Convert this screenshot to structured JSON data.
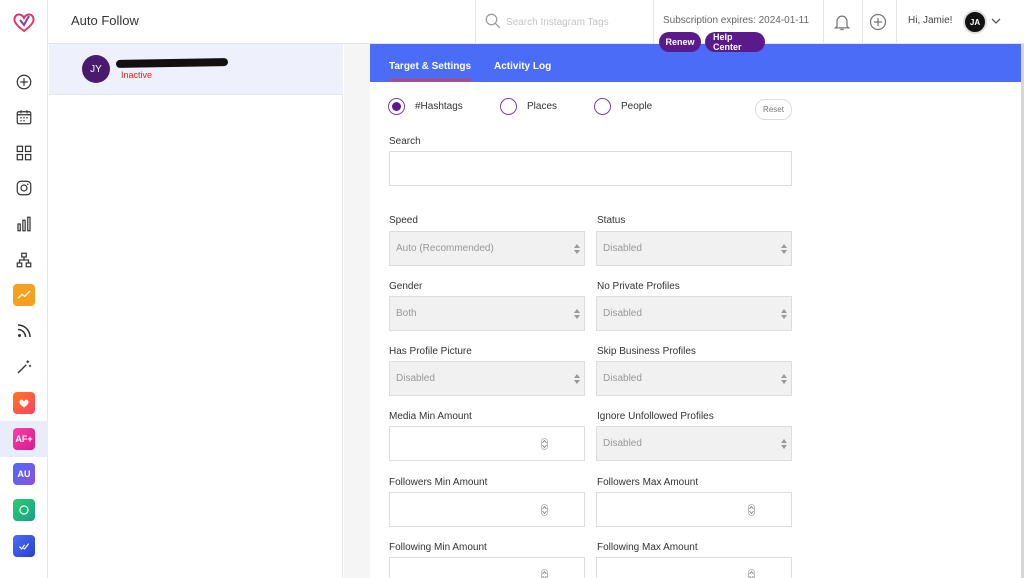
{
  "colors": {
    "brand": "#5a1a8c",
    "tabbar": "#4b6cf7",
    "tab_active_underline": "#e63a3a",
    "status_inactive": "#e0271f",
    "rail_active_bg": "#e9ecf9"
  },
  "rail": {
    "logo": "heart-logo",
    "items": [
      {
        "icon": "plus-circle-icon"
      },
      {
        "icon": "calendar-icon"
      },
      {
        "icon": "grid-icon"
      },
      {
        "icon": "instagram-icon"
      },
      {
        "icon": "bar-chart-icon"
      },
      {
        "icon": "hierarchy-icon"
      },
      {
        "icon": "trend-icon"
      },
      {
        "icon": "rss-icon"
      },
      {
        "icon": "magic-wand-icon"
      },
      {
        "icon": "auto-like-icon"
      },
      {
        "icon": "auto-follow-icon",
        "badge": "AF+",
        "active": true
      },
      {
        "icon": "auto-unfollow-icon",
        "badge": "AU"
      },
      {
        "icon": "auto-dm-icon"
      },
      {
        "icon": "checkmark-icon"
      }
    ]
  },
  "header": {
    "title": "Auto Follow",
    "search_placeholder": "Search Instagram Tags",
    "subscription_text": "Subscription expires: 2024-01-11",
    "renew_label": "Renew",
    "help_label": "Help Center",
    "greeting": "Hi, Jamie!",
    "avatar_initials": "JA"
  },
  "account": {
    "initials": "JY",
    "status": "Inactive"
  },
  "tabs": [
    {
      "label": "Target & Settings",
      "active": true
    },
    {
      "label": "Activity Log",
      "active": false
    }
  ],
  "target_types": [
    {
      "label": "#Hashtags",
      "selected": true
    },
    {
      "label": "Places",
      "selected": false
    },
    {
      "label": "People",
      "selected": false
    }
  ],
  "reset_label": "Reset",
  "search_label": "Search",
  "fields": {
    "speed": {
      "label": "Speed",
      "value": "Auto (Recommended)"
    },
    "status": {
      "label": "Status",
      "value": "Disabled"
    },
    "gender": {
      "label": "Gender",
      "value": "Both"
    },
    "no_private": {
      "label": "No Private Profiles",
      "value": "Disabled"
    },
    "has_picture": {
      "label": "Has Profile Picture",
      "value": "Disabled"
    },
    "skip_business": {
      "label": "Skip Business Profiles",
      "value": "Disabled"
    },
    "media_min": {
      "label": "Media Min Amount",
      "value": ""
    },
    "ignore_unfollowed": {
      "label": "Ignore Unfollowed Profiles",
      "value": "Disabled"
    },
    "followers_min": {
      "label": "Followers Min Amount",
      "value": ""
    },
    "followers_max": {
      "label": "Followers Max Amount",
      "value": ""
    },
    "following_min": {
      "label": "Following Min Amount",
      "value": ""
    },
    "following_max": {
      "label": "Following Max Amount",
      "value": ""
    }
  }
}
